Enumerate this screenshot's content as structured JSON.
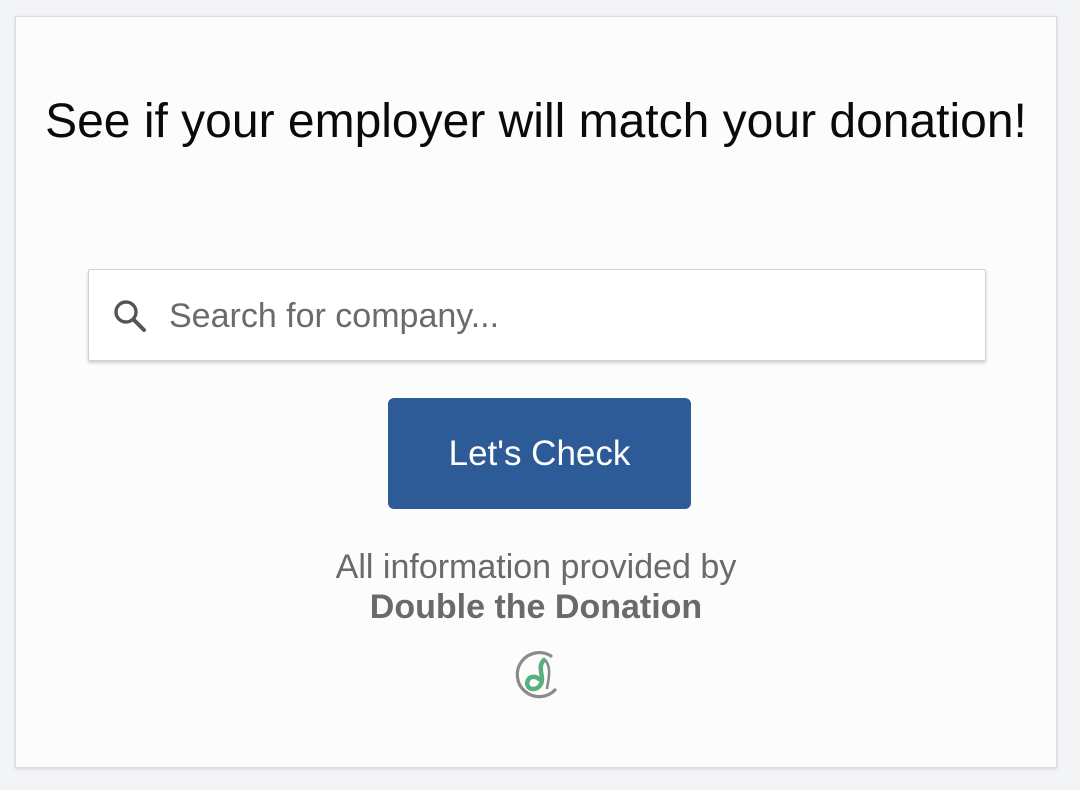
{
  "widget": {
    "title": "See if your employer will match your donation!",
    "search": {
      "placeholder": "Search for company...",
      "value": "",
      "icon": "search-icon"
    },
    "button_label": "Let's Check",
    "credit_line": "All information provided by",
    "provider_name": "Double the Donation",
    "logo_icon": "double-the-donation-logo-icon"
  },
  "colors": {
    "button_bg": "#2d5b98",
    "button_text": "#ffffff",
    "logo_green": "#58b07c",
    "logo_gray": "#8a8a8a"
  }
}
